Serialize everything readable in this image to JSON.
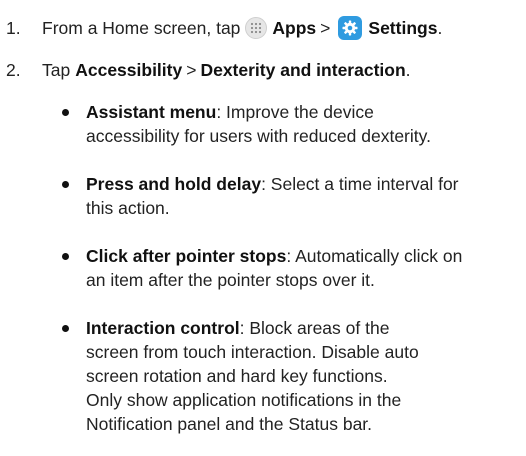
{
  "steps": [
    {
      "number": "1.",
      "prefix": "From a Home screen, tap",
      "apps_label": "Apps",
      "separator": ">",
      "settings_label": "Settings",
      "suffix": "."
    },
    {
      "number": "2.",
      "prefix": "Tap",
      "accessibility_label": "Accessibility",
      "separator": ">",
      "dexterity_label": "Dexterity and interaction",
      "suffix": "."
    }
  ],
  "bullets": [
    {
      "term": "Assistant menu",
      "lines": [
        ": Improve the device",
        "accessibility for users with reduced dexterity."
      ]
    },
    {
      "term": "Press and hold delay",
      "lines": [
        ": Select a time interval for",
        "this action."
      ]
    },
    {
      "term": "Click after pointer stops",
      "lines": [
        ": Automatically click on",
        "an item after the pointer stops over it."
      ]
    },
    {
      "term": "Interaction control",
      "lines": [
        ": Block areas of the",
        "screen from touch interaction. Disable auto",
        "screen rotation and hard key functions.",
        "Only show application notifications in the",
        "Notification panel and the Status bar."
      ]
    }
  ],
  "icons": {
    "apps": "apps-grid-icon",
    "settings": "settings-gear-icon",
    "settings_color": "#2f9be0"
  }
}
